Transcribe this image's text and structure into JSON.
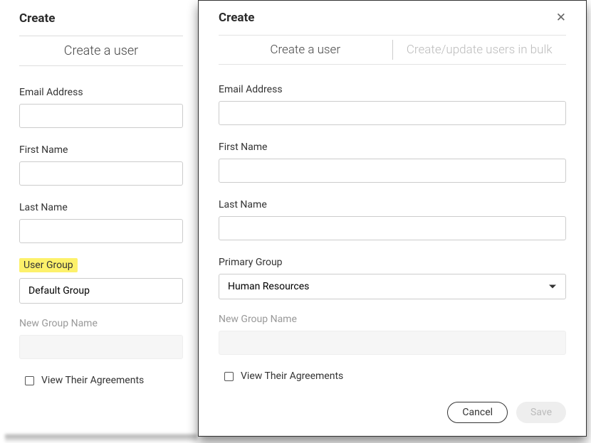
{
  "back": {
    "title": "Create",
    "tab_label": "Create a user",
    "email_label": "Email Address",
    "first_name_label": "First Name",
    "last_name_label": "Last Name",
    "user_group_label": "User Group",
    "user_group_value": "Default Group",
    "new_group_label": "New Group Name",
    "view_agreements_label": "View Their Agreements"
  },
  "front": {
    "title": "Create",
    "tabs": {
      "create_user": "Create a user",
      "bulk": "Create/update users in bulk"
    },
    "email_label": "Email Address",
    "first_name_label": "First Name",
    "last_name_label": "Last Name",
    "primary_group_label": "Primary Group",
    "primary_group_value": "Human Resources",
    "new_group_label": "New Group Name",
    "view_agreements_label": "View Their Agreements",
    "cancel_label": "Cancel",
    "save_label": "Save"
  }
}
